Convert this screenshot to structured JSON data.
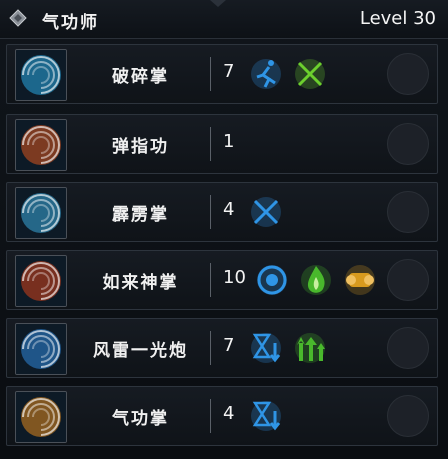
{
  "header": {
    "title": "气功师",
    "level": "Level 30",
    "class_icon": "diamond-gem-icon"
  },
  "skills": [
    {
      "name": "破碎掌",
      "rank": "7",
      "icon": "shattering-palm-icon",
      "color": "#29a7e0",
      "effects": [
        {
          "icon": "running-figure-icon",
          "color": "#2f95e6"
        },
        {
          "icon": "crossed-swords-icon",
          "color": "#6ccf2e"
        }
      ]
    },
    {
      "name": "弹指功",
      "rank": "1",
      "icon": "flick-strike-icon",
      "color": "#d8561e",
      "effects": []
    },
    {
      "name": "霹雳掌",
      "rank": "4",
      "icon": "thunder-palm-icon",
      "color": "#3aa7d8",
      "effects": [
        {
          "icon": "crossed-swords-icon",
          "color": "#2f95e6"
        }
      ]
    },
    {
      "name": "如来神掌",
      "rank": "10",
      "icon": "buddha-palm-icon",
      "color": "#d1421a",
      "effects": [
        {
          "icon": "vortex-orb-icon",
          "color": "#2f95e6"
        },
        {
          "icon": "green-flame-icon",
          "color": "#49b82c"
        },
        {
          "icon": "gold-scroll-icon",
          "color": "#d89a1e"
        }
      ]
    },
    {
      "name": "风雷一光炮",
      "rank": "7",
      "icon": "wind-thunder-cannon-icon",
      "color": "#2f86d8",
      "effects": [
        {
          "icon": "hourglass-down-icon",
          "color": "#2f95e6"
        },
        {
          "icon": "stat-up-arrows-icon",
          "color": "#49b82c"
        }
      ]
    },
    {
      "name": "气功掌",
      "rank": "4",
      "icon": "qigong-palm-icon",
      "color": "#e0891e",
      "effects": [
        {
          "icon": "hourglass-down-icon",
          "color": "#2f95e6"
        }
      ]
    }
  ]
}
